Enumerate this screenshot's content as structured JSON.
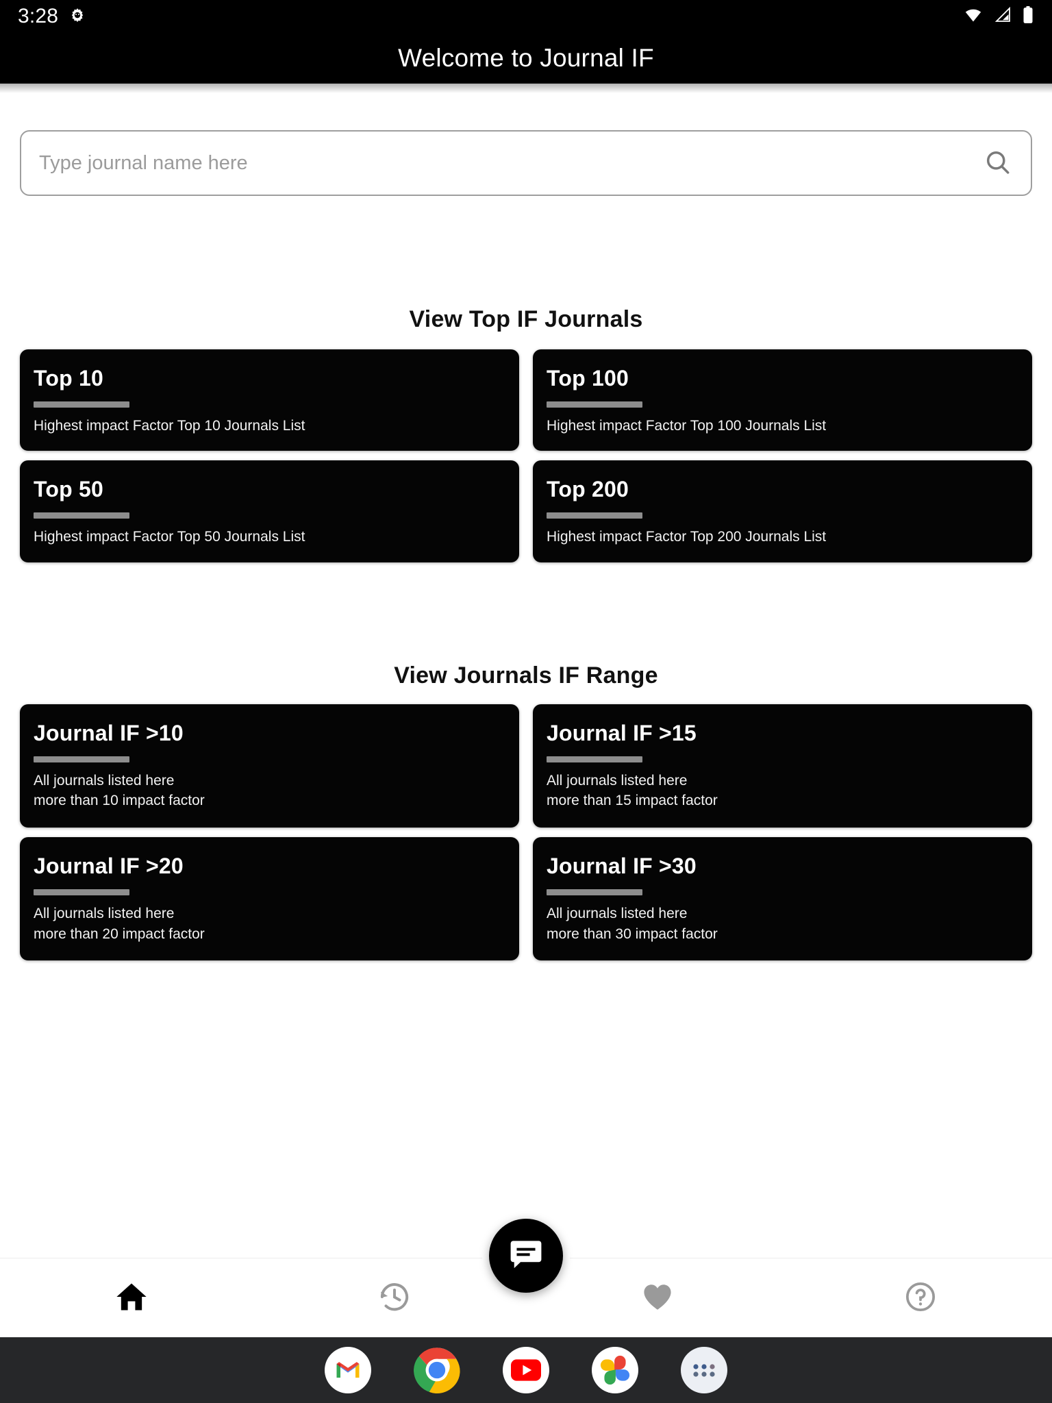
{
  "statusbar": {
    "time": "3:28",
    "icons": [
      "settings-gear-icon",
      "wifi-icon",
      "cellular-signal-icon",
      "battery-icon"
    ]
  },
  "appbar": {
    "title": "Welcome to Journal IF"
  },
  "search": {
    "value": "",
    "placeholder": "Type journal name here",
    "icon": "search-icon"
  },
  "sections": [
    {
      "heading": "View Top IF Journals",
      "rows": [
        [
          {
            "title": "Top 10",
            "subtitle": "Highest impact Factor Top 10 Journals List"
          },
          {
            "title": "Top 100",
            "subtitle": "Highest impact Factor Top 100 Journals List"
          }
        ],
        [
          {
            "title": "Top 50",
            "subtitle": "Highest impact Factor Top 50 Journals List"
          },
          {
            "title": "Top 200",
            "subtitle": "Highest impact Factor Top 200 Journals List"
          }
        ]
      ]
    },
    {
      "heading": "View Journals IF Range",
      "rows": [
        [
          {
            "title": "Journal IF >10",
            "subtitle": "All journals listed here\nmore than 10 impact factor"
          },
          {
            "title": "Journal IF >15",
            "subtitle": "All journals listed here\nmore than 15 impact factor"
          }
        ],
        [
          {
            "title": "Journal IF >20",
            "subtitle": "All journals listed here\nmore than 20 impact factor"
          },
          {
            "title": "Journal IF >30",
            "subtitle": "All journals listed here\nmore than 30 impact factor"
          }
        ]
      ]
    }
  ],
  "bottomnav": {
    "items": [
      {
        "icon": "home-icon",
        "active": true
      },
      {
        "icon": "history-icon",
        "active": false
      },
      {
        "icon": "heart-icon",
        "active": false
      },
      {
        "icon": "help-icon",
        "active": false
      }
    ],
    "fab": {
      "icon": "chat-message-icon"
    }
  },
  "taskbar": {
    "apps": [
      "gmail-icon",
      "chrome-icon",
      "youtube-icon",
      "google-photos-icon",
      "app-drawer-icon"
    ]
  },
  "colors": {
    "card_bg": "#050505",
    "appbar_bg": "#000000",
    "page_bg": "#ffffff",
    "rule": "#8d8d8d",
    "inactive_nav": "#9a9a9a",
    "taskbar_bg": "#262729"
  }
}
